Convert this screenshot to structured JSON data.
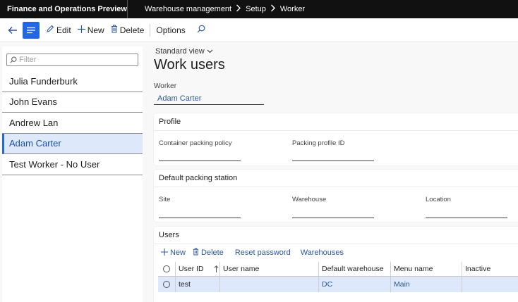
{
  "topbar": {
    "app_title": "Finance and Operations Preview",
    "breadcrumbs": [
      "Warehouse management",
      "Setup",
      "Worker"
    ]
  },
  "actionbar": {
    "edit_label": "Edit",
    "new_label": "New",
    "delete_label": "Delete",
    "options_label": "Options"
  },
  "list": {
    "filter_placeholder": "Filter",
    "items": [
      "Julia Funderburk",
      "John Evans",
      "Andrew Lan",
      "Adam Carter",
      "Test Worker - No User"
    ],
    "selected": "Adam Carter"
  },
  "main": {
    "view_selector": "Standard view",
    "page_title": "Work users",
    "worker_label": "Worker",
    "worker_value": "Adam Carter"
  },
  "profile": {
    "title": "Profile",
    "container_packing_policy_label": "Container packing policy",
    "packing_profile_id_label": "Packing profile ID"
  },
  "packing_station": {
    "title": "Default packing station",
    "site_label": "Site",
    "warehouse_label": "Warehouse",
    "location_label": "Location"
  },
  "users": {
    "title": "Users",
    "new_label": "New",
    "delete_label": "Delete",
    "reset_password_label": "Reset password",
    "warehouses_label": "Warehouses",
    "columns": [
      "User ID",
      "User name",
      "Default warehouse",
      "Menu name",
      "Inactive"
    ],
    "rows": [
      {
        "user_id": "test",
        "user_name": "",
        "default_warehouse": "DC",
        "menu_name": "Main",
        "inactive": ""
      }
    ]
  },
  "colors": {
    "accent": "#2266e3",
    "link": "#2b579a",
    "selected_bg": "#dde8fb",
    "topbar_bg": "#111111"
  }
}
